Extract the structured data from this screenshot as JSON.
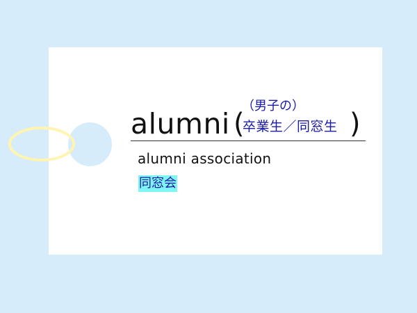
{
  "card": {
    "headword": "alumni",
    "paren_open": "(",
    "paren_close": ")",
    "note": "（男子の）",
    "gloss": "卒業生／同窓生",
    "phrase": "alumni association",
    "phrase_translation": "同窓会"
  },
  "colors": {
    "background": "#d7ecfa",
    "card": "#ffffff",
    "ring": "#fff5b0",
    "japanese_text": "#1a1aa8",
    "highlight": "#7ff5f5"
  }
}
